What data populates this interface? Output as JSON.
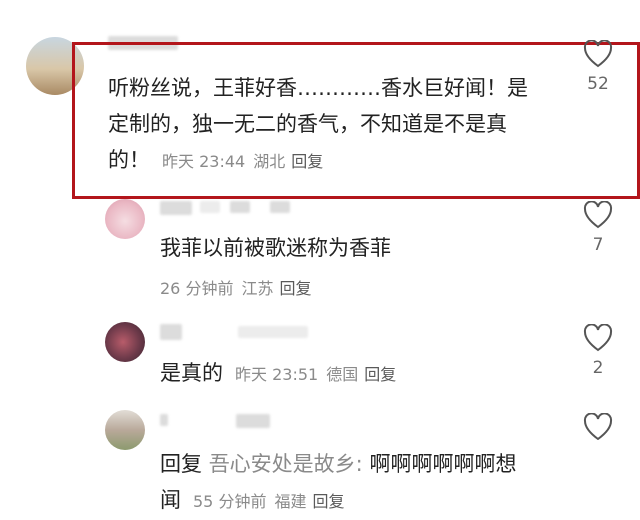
{
  "comments": [
    {
      "text": "听粉丝说，王菲好香…………香水巨好闻！是定制的，独一无二的香气，不知道是不是真的！",
      "text_line1": "听粉丝说，王菲好香…………香水巨好闻！是",
      "text_line2": "定制的，独一无二的香气，不知道是不是真",
      "text_line3": "的！",
      "time": "昨天 23:44",
      "location": "湖北",
      "reply_label": "回复",
      "likes": "52",
      "highlighted": true
    },
    {
      "text": "我菲以前被歌迷称为香菲",
      "time": "26 分钟前",
      "location": "江苏",
      "reply_label": "回复",
      "likes": "7"
    },
    {
      "text": "是真的",
      "time": "昨天 23:51",
      "location": "德国",
      "reply_label": "回复",
      "likes": "2"
    },
    {
      "text_prefix": "回复",
      "reply_to": "吾心安处是故乡:",
      "text_line1": "啊啊啊啊啊啊想",
      "text_line2": "闻",
      "time": "55 分钟前",
      "location": "福建",
      "reply_label": "回复",
      "likes": ""
    }
  ],
  "colors": {
    "highlight_border": "#b3151b",
    "meta_text": "#8a8a8a",
    "body_text": "#222222"
  }
}
